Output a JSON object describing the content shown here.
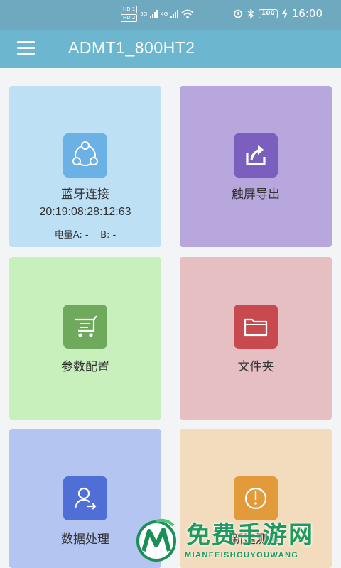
{
  "status_bar": {
    "time": "16:00",
    "battery": "100",
    "network": "5G",
    "network2": "4G",
    "sim1": "HD 1",
    "sim2": "HD 2"
  },
  "app_bar": {
    "title": "ADMT1_800HT2",
    "menu_icon": "hamburger-menu-icon"
  },
  "tiles": [
    {
      "label": "蓝牙连接",
      "icon": "share-nodes-icon",
      "bg": "#bde0f5",
      "icon_bg": "#6cb1e6",
      "subtitle": "20:19:08:28:12:63",
      "info": "电量A: -    B: -"
    },
    {
      "label": "触屏导出",
      "icon": "export-icon",
      "bg": "#b8a7dc",
      "icon_bg": "#7a5fbf"
    },
    {
      "label": "参数配置",
      "icon": "cart-icon",
      "bg": "#c8f0bd",
      "icon_bg": "#6fa95c"
    },
    {
      "label": "文件夹",
      "icon": "folder-icon",
      "bg": "#e6bfc3",
      "icon_bg": "#c94a4e"
    },
    {
      "label": "数据处理",
      "icon": "user-transfer-icon",
      "bg": "#b4c5f2",
      "icon_bg": "#4f6fd6"
    },
    {
      "label": "新建测量",
      "icon": "gauge-icon",
      "bg": "#f2dcbd",
      "icon_bg": "#e39a3a"
    }
  ],
  "watermark": {
    "cn": "免费手游网",
    "en": "MIANFEISHOUYOUWANG"
  }
}
